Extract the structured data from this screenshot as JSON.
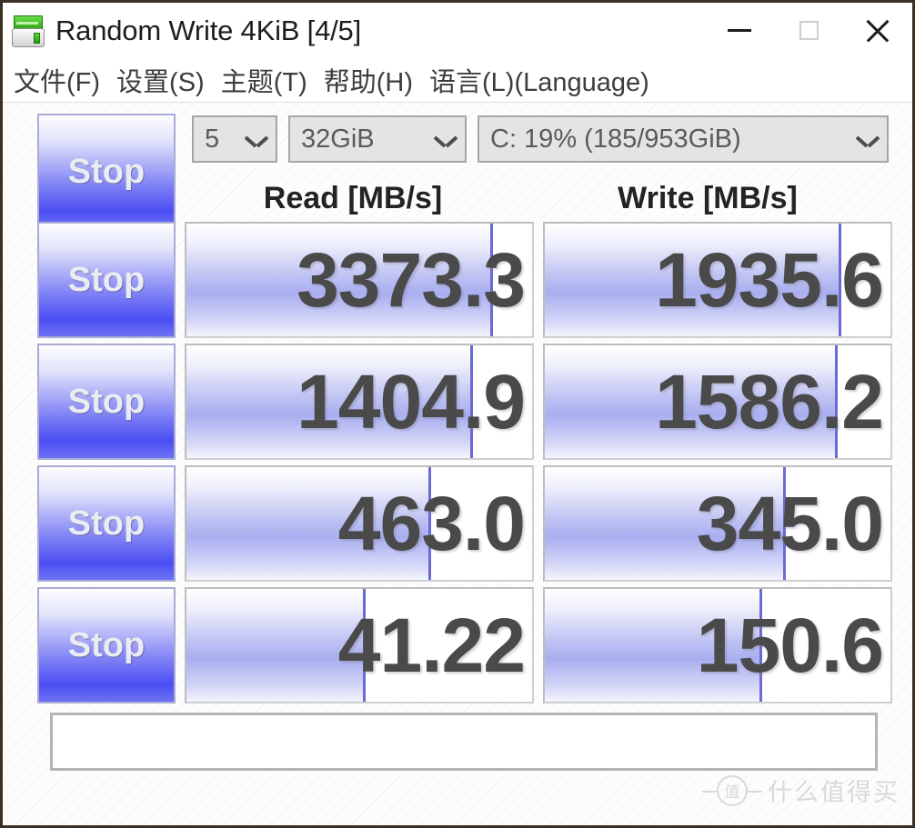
{
  "window": {
    "title": "Random Write 4KiB [4/5]",
    "icon": "disk-drive-icon",
    "controls": {
      "minimize": "minimize-icon",
      "maximize": "maximize-icon",
      "close": "close-icon"
    }
  },
  "menu": {
    "items": [
      {
        "label": "文件(F)"
      },
      {
        "label": "设置(S)"
      },
      {
        "label": "主题(T)"
      },
      {
        "label": "帮助(H)"
      },
      {
        "label": "语言(L)(Language)"
      }
    ]
  },
  "toolbar": {
    "all_button_label": "Stop",
    "test_count": "5",
    "test_size": "32GiB",
    "drive": "C: 19% (185/953GiB)"
  },
  "table": {
    "headers": {
      "read": "Read [MB/s]",
      "write": "Write [MB/s]"
    },
    "rows": [
      {
        "button_label": "Stop",
        "read_value": "3373.3",
        "write_value": "1935.6",
        "read_fill_pct": "88%",
        "write_fill_pct": "85%"
      },
      {
        "button_label": "Stop",
        "read_value": "1404.9",
        "write_value": "1586.2",
        "read_fill_pct": "82%",
        "write_fill_pct": "84%"
      },
      {
        "button_label": "Stop",
        "read_value": "463.0",
        "write_value": "345.0",
        "read_fill_pct": "70%",
        "write_fill_pct": "69%"
      },
      {
        "button_label": "Stop",
        "read_value": "41.22",
        "write_value": "150.6",
        "read_fill_pct": "51%",
        "write_fill_pct": "62%"
      }
    ]
  },
  "status": {
    "text": ""
  },
  "watermark": {
    "mark": "值",
    "text": "什么值得买"
  },
  "colors": {
    "accent_blue": "#4b4ef2",
    "bar_lavender": "#a9aef0",
    "bar_edge": "#6a6ad6",
    "value_text": "#4a4a4a",
    "window_border": "#3b2e22"
  }
}
